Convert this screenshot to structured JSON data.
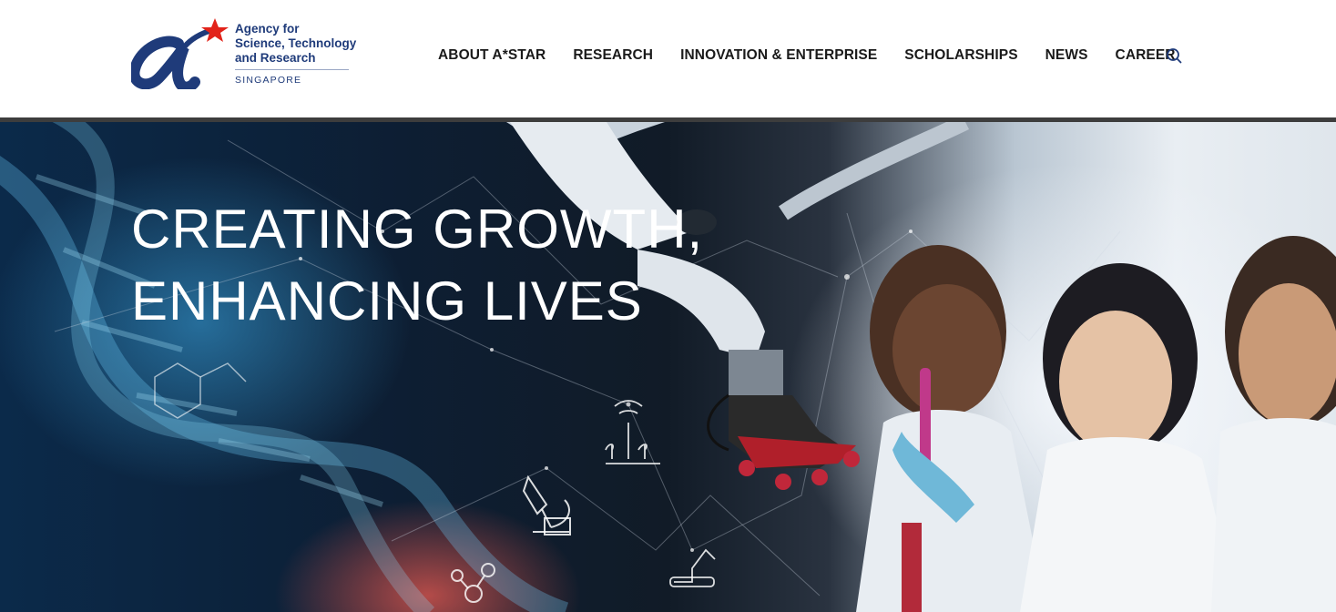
{
  "header": {
    "logo": {
      "line1": "Agency for",
      "line2": "Science, Technology",
      "line3": "and Research",
      "country": "SINGAPORE",
      "mark_icon": "astar-logo-mark"
    },
    "nav": [
      {
        "label": "ABOUT A*STAR"
      },
      {
        "label": "RESEARCH"
      },
      {
        "label": "INNOVATION & ENTERPRISE"
      },
      {
        "label": "SCHOLARSHIPS"
      },
      {
        "label": "NEWS"
      },
      {
        "label": "CAREER"
      }
    ],
    "search_icon": "search-icon"
  },
  "hero": {
    "title_line1": "CREATING GROWTH,",
    "title_line2": "ENHANCING LIVES",
    "image_description_icons": [
      "dna-helix-icon",
      "robot-arm-icon",
      "microscope-icon",
      "plant-sensor-icon",
      "molecule-icon",
      "scientists-photo"
    ]
  },
  "colors": {
    "brand_blue": "#1f3b7a",
    "brand_red": "#e2231a",
    "header_bar": "#3d3d3d",
    "nav_text": "#1a1a1a",
    "hero_text": "#ffffff"
  }
}
